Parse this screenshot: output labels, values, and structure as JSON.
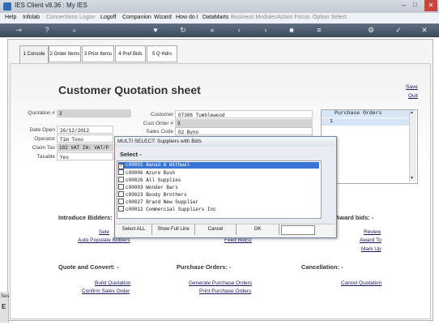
{
  "window": {
    "title": "IES Client v8.36 : My IES"
  },
  "menu": [
    {
      "label": "Help",
      "enabled": true
    },
    {
      "label": "Infolab",
      "enabled": true
    },
    {
      "label": "Connections",
      "enabled": false
    },
    {
      "label": "Logon",
      "enabled": false
    },
    {
      "label": "Logoff",
      "enabled": true
    },
    {
      "label": "Companion",
      "enabled": true
    },
    {
      "label": "Wizard",
      "enabled": true
    },
    {
      "label": "How do I",
      "enabled": true
    },
    {
      "label": "DataMarts",
      "enabled": true
    },
    {
      "label": "Business Modules",
      "enabled": false
    },
    {
      "label": "Action Focus",
      "enabled": false
    },
    {
      "label": "Option Select",
      "enabled": false
    }
  ],
  "toolbar_icons": [
    "key-icon",
    "help-icon",
    "search-icon",
    "heart-icon",
    "refresh-icon",
    "rewind-icon",
    "back-icon",
    "forward-icon",
    "stop-icon",
    "menu-icon",
    "settings-icon",
    "check-icon",
    "close-icon"
  ],
  "tabs": [
    {
      "label": "1 Console",
      "active": true
    },
    {
      "label": "2 Order Items",
      "active": false
    },
    {
      "label": "3 Prior Items",
      "active": false
    },
    {
      "label": "4 Pref Bids",
      "active": false
    },
    {
      "label": "5 Q Hdrs",
      "active": false
    }
  ],
  "page": {
    "title": "Customer Quotation sheet",
    "save": "Save",
    "quit": "Quit"
  },
  "form": {
    "quotation_label": "Quotation #",
    "quotation_value": "3",
    "date_open_label": "Date Open",
    "date_open_value": "26/12/2012",
    "operator_label": "Operator",
    "operator_value": "Tim Tono",
    "claim_tax_label": "Claim Tax",
    "claim_tax_value": "102 VAT IN: VAT/P",
    "taxable_label": "Taxable",
    "taxable_value": "Yes",
    "customer_label": "Customer",
    "customer_value": "07306 Tumblewood",
    "cust_order_label": "Cust Order #",
    "cust_order_value": "3",
    "sales_code_label": "Sales Code",
    "sales_code_value": "02 Byno"
  },
  "purchase_orders": {
    "header": "Purchase Orders",
    "row1": "1"
  },
  "sections": {
    "introduce_bidders": "Introduce Bidders: -",
    "award_bids": "Award bids: -",
    "quote_convert": "Quote and Convert: -",
    "purchase_orders": "Purchase Orders: -",
    "cancellation": "Cancellation: -"
  },
  "links": {
    "select_partial": "Sele",
    "auto_populate": "Auto Populate Bidders",
    "feed_bids": "Feed Bid(s)",
    "review": "Review",
    "award_to": "Award To",
    "mark_up": "Mark Up",
    "build_quotation": "Build Quotation",
    "confirm_sales_order": "Confirm Sales Order",
    "generate_po": "Generate Purchase Orders",
    "print_po": "Print Purchase Orders",
    "cancel_quotation": "Cancel Quotation"
  },
  "left_edge": {
    "text1": "Ses",
    "text2": "E"
  },
  "dialog": {
    "title": "MULTI SELECT: Suppliers with Bids",
    "header": "Select -",
    "items": [
      {
        "text": "c00001 Aanad & Withwal",
        "checked": true,
        "selected": true
      },
      {
        "text": "c00006 Azure Bush",
        "checked": false,
        "selected": false
      },
      {
        "text": "c00026 All Supplies",
        "checked": false,
        "selected": false
      },
      {
        "text": "c00003 Wonder Bars",
        "checked": false,
        "selected": false
      },
      {
        "text": "c00023 Boody Brothers",
        "checked": false,
        "selected": false
      },
      {
        "text": "c00027 Brand New Supplier",
        "checked": false,
        "selected": false
      },
      {
        "text": "c00012 Commercial Suppliers Inc",
        "checked": false,
        "selected": false
      }
    ],
    "buttons": {
      "select_all": "Select ALL",
      "show_full_line": "Show Full Line",
      "cancel": "Cancel",
      "ok": "OK"
    },
    "filter_value": ""
  }
}
